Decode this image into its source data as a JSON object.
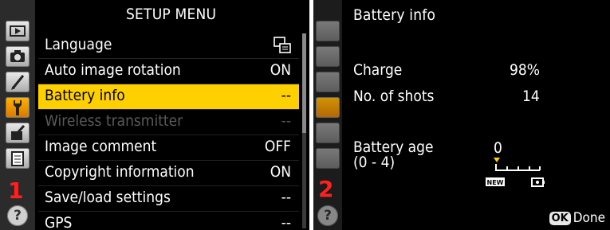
{
  "left_screen": {
    "title": "SETUP MENU",
    "badge": "1",
    "tabs": [
      {
        "name": "playback-tab"
      },
      {
        "name": "shooting-tab"
      },
      {
        "name": "custom-settings-tab"
      },
      {
        "name": "setup-tab"
      },
      {
        "name": "retouch-tab"
      },
      {
        "name": "my-menu-tab"
      }
    ],
    "help": "?",
    "items": [
      {
        "label": "Language",
        "value": ""
      },
      {
        "label": "Auto image rotation",
        "value": "ON"
      },
      {
        "label": "Battery info",
        "value": "--"
      },
      {
        "label": "Wireless transmitter",
        "value": "--"
      },
      {
        "label": "Image comment",
        "value": "OFF"
      },
      {
        "label": "Copyright information",
        "value": "ON"
      },
      {
        "label": "Save/load settings",
        "value": "--"
      },
      {
        "label": "GPS",
        "value": "--"
      }
    ],
    "selected_index": 2,
    "disabled_index": 3
  },
  "right_screen": {
    "title": "Battery info",
    "badge": "2",
    "help": "?",
    "charge_label": "Charge",
    "charge_value": "98%",
    "shots_label": "No. of shots",
    "shots_value": "14",
    "age_label_line1": "Battery age",
    "age_label_line2": "(0 - 4)",
    "age_value": "0",
    "scale_new": "NEW",
    "ok_badge": "OK",
    "done_label": "Done"
  },
  "colors": {
    "highlight": "#ffd000",
    "tab_active": "#f0a000",
    "badge": "#ff2020"
  }
}
